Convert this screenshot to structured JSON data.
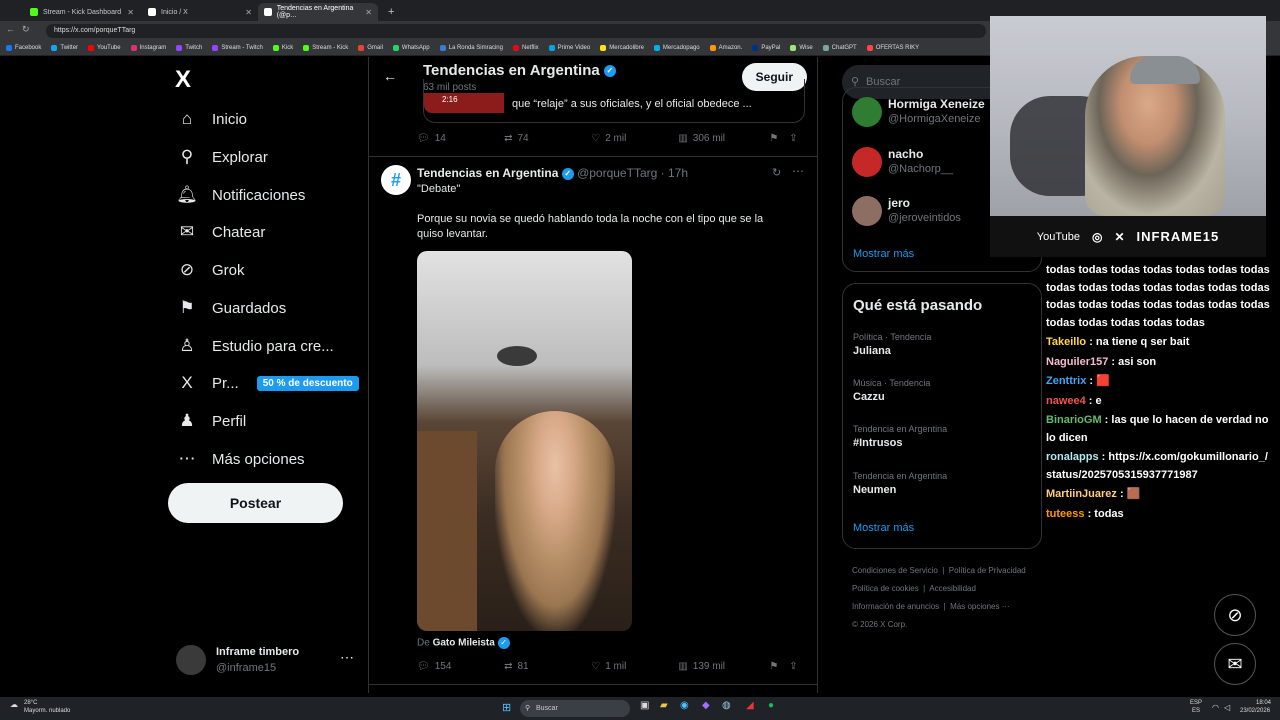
{
  "browser": {
    "tabs": [
      {
        "label": "Stream - Kick Dashboard",
        "color": "#53fc18"
      },
      {
        "label": "Inicio / X",
        "color": "#000000"
      },
      {
        "label": "Tendencias en Argentina (@p…",
        "color": "#000000"
      }
    ],
    "url": "https://x.com/porqueTTarg",
    "bookmarks": [
      "Facebook",
      "Twitter",
      "YouTube",
      "Instagram",
      "Twitch",
      "Stream - Twitch",
      "Kick",
      "Stream - Kick",
      "Gmail",
      "WhatsApp",
      "La Ronda Simracing",
      "Netflix",
      "Prime Video",
      "Mercadolibre",
      "Mercadopago",
      "Amazon.",
      "PayPal",
      "Wise",
      "ChatGPT",
      "OFERTAS RIKY"
    ]
  },
  "nav": {
    "logo": "X",
    "items": [
      {
        "label": "Inicio",
        "icon": "⌂"
      },
      {
        "label": "Explorar",
        "icon": "⚲"
      },
      {
        "label": "Notificaciones",
        "icon": "🔔︎"
      },
      {
        "label": "Chatear",
        "icon": "✉"
      },
      {
        "label": "Grok",
        "icon": "⊘"
      },
      {
        "label": "Guardados",
        "icon": "⚑"
      },
      {
        "label": "Estudio para cre...",
        "icon": "♙"
      },
      {
        "label": "Pr...",
        "icon": "X"
      },
      {
        "label": "Perfil",
        "icon": "♟"
      },
      {
        "label": "Más opciones",
        "icon": "⋯"
      }
    ],
    "premium_badge": "50 % de descuento",
    "post_label": "Postear",
    "account_name": "Inframe timbero",
    "account_handle": "@inframe15"
  },
  "header": {
    "title": "Tendencias en Argentina",
    "posts": "63 mil posts",
    "follow": "Seguir"
  },
  "prev_tweet": {
    "quote_tail": "que “relaje” a sus oficiales, y el oficial obedece ...",
    "quote_duration": "2:16",
    "replies": "14",
    "retweets": "74",
    "likes": "2 mil",
    "views": "306 mil"
  },
  "tweet": {
    "name": "Tendencias en Argentina",
    "handle": "@porqueTTarg",
    "time": "17h",
    "line1": "\"Debate\"",
    "text": "Porque su novia se quedó hablando toda la noche con el tipo que se la quiso levantar.",
    "source_prefix": "De",
    "source": "Gato Mileista",
    "replies": "154",
    "retweets": "81",
    "likes": "1 mil",
    "views": "139 mil"
  },
  "right": {
    "search_placeholder": "Buscar",
    "who": [
      {
        "name": "Hormiga Xeneize",
        "handle": "@HormigaXeneize",
        "color": "#2e7d32"
      },
      {
        "name": "nacho",
        "handle": "@Nachorp__",
        "color": "#c62828"
      },
      {
        "name": "jero",
        "handle": "@jeroveintidos",
        "color": "#8d6e63"
      }
    ],
    "show_more": "Mostrar más",
    "trending_title": "Qué está pasando",
    "trends": [
      {
        "context": "Política · Tendencia",
        "topic": "Juliana"
      },
      {
        "context": "Música · Tendencia",
        "topic": "Cazzu"
      },
      {
        "context": "Tendencia en Argentina",
        "topic": "#Intrusos"
      },
      {
        "context": "Tendencia en Argentina",
        "topic": "Neumen"
      }
    ],
    "trend_more": "Mostrar más",
    "footer": [
      "Condiciones de Servicio",
      "Política de Privacidad",
      "Política de cookies",
      "Accesibilidad",
      "Información de anuncios",
      "Más opciones ···",
      "© 2026 X Corp."
    ]
  },
  "cam": {
    "youtube": "YouTube",
    "brand": "INFRAME15"
  },
  "chat": {
    "spam": "todas todas todas todas todas todas todas todas todas todas todas todas todas todas todas todas todas todas todas todas todas todas todas todas todas todas",
    "messages": [
      {
        "user": "Takeillo",
        "color": "#ffd54f",
        "text": " : na tiene q ser bait"
      },
      {
        "user": "Naguiler157",
        "color": "#f8bbd0",
        "text": " : asi son"
      },
      {
        "user": "Zenttrix",
        "color": "#42a5f5",
        "text": " : 🟥"
      },
      {
        "user": "nawee4",
        "color": "#ef5350",
        "text": " : e"
      },
      {
        "user": "BinarioGM",
        "color": "#66bb6a",
        "text": " : las que lo hacen de verdad no lo dicen"
      },
      {
        "user": "ronalapps",
        "color": "#b2ebf2",
        "text": " : https://x.com/gokumillonario_/status/2025705315937771987"
      },
      {
        "user": "MartiinJuarez",
        "color": "#ffcc80",
        "text": " : 🟫"
      },
      {
        "user": "tuteess",
        "color": "#ff9800",
        "text": " : todas"
      }
    ]
  },
  "taskbar": {
    "weather_temp": "28°C",
    "weather_desc": "Mayorm. nublado",
    "search": "Buscar",
    "lang": "ESP",
    "lang2": "ES",
    "time": "18:04",
    "date": "23/02/2026"
  }
}
